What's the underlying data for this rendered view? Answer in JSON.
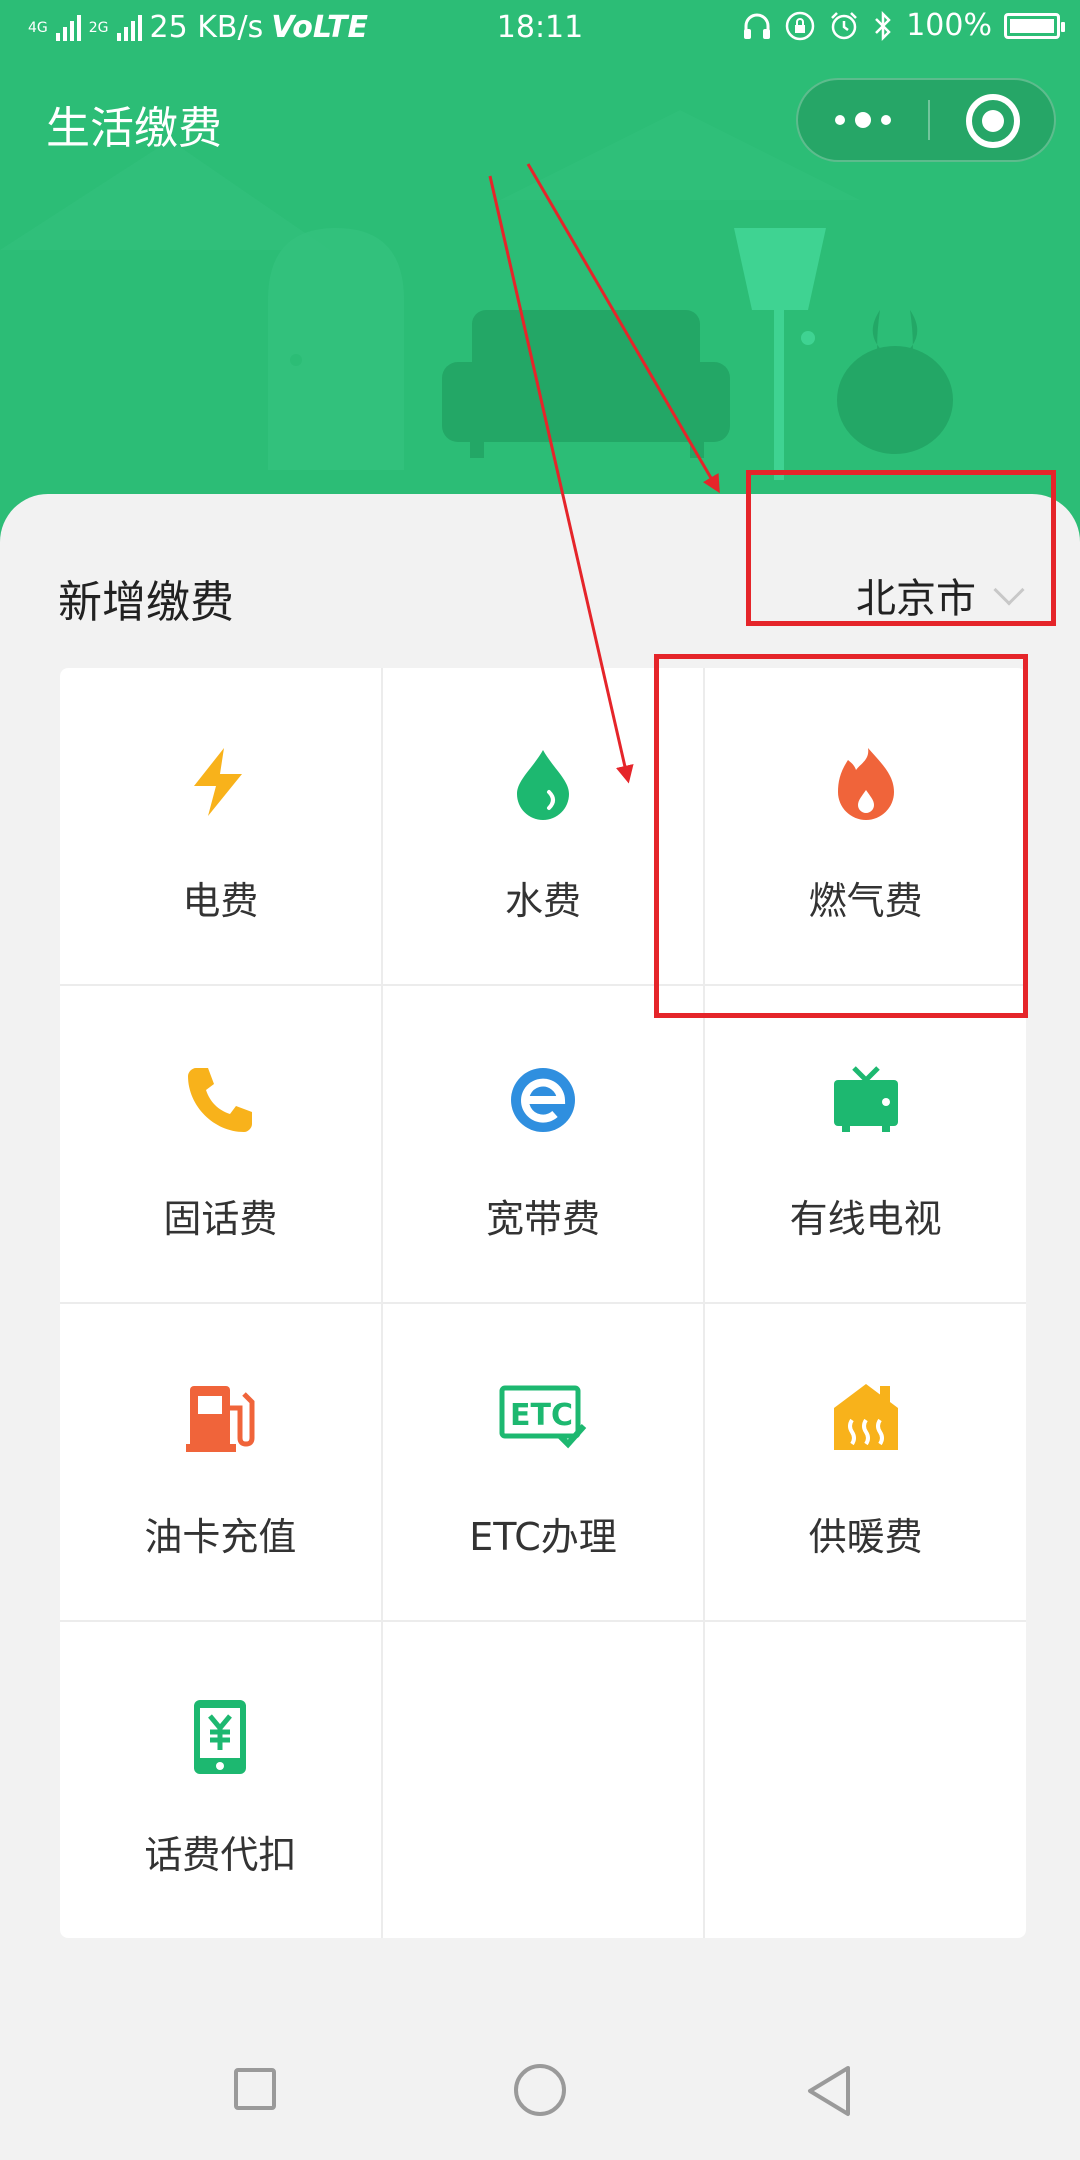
{
  "status_bar": {
    "network_a": "4G",
    "network_b": "2G",
    "speed": "25 KB/s",
    "volte": "VoLTE",
    "time": "18:11",
    "battery": "100%"
  },
  "header": {
    "title": "生活缴费",
    "color": "#2cbd76"
  },
  "section": {
    "title": "新增缴费",
    "city": "北京市"
  },
  "services": [
    {
      "label": "电费",
      "icon": "lightning-icon",
      "color": "#f8b21b"
    },
    {
      "label": "水费",
      "icon": "water-drop-icon",
      "color": "#1db870"
    },
    {
      "label": "燃气费",
      "icon": "flame-icon",
      "color": "#f0643a"
    },
    {
      "label": "固话费",
      "icon": "phone-icon",
      "color": "#f8b21b"
    },
    {
      "label": "宽带费",
      "icon": "broadband-e-icon",
      "color": "#2f8fdf"
    },
    {
      "label": "有线电视",
      "icon": "tv-icon",
      "color": "#1db870"
    },
    {
      "label": "油卡充值",
      "icon": "fuel-pump-icon",
      "color": "#f0643a"
    },
    {
      "label": "ETC办理",
      "icon": "etc-icon",
      "color": "#1db870"
    },
    {
      "label": "供暖费",
      "icon": "heating-icon",
      "color": "#f8b21b"
    },
    {
      "label": "话费代扣",
      "icon": "mobile-yuan-icon",
      "color": "#1db870"
    }
  ]
}
